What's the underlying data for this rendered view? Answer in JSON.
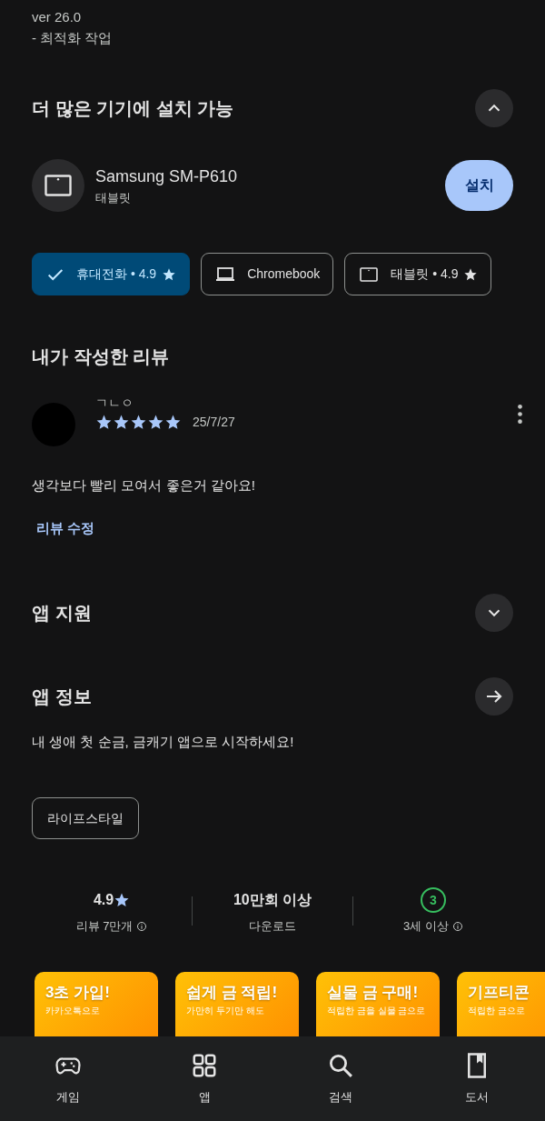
{
  "whats_new": [
    "ver 26.0",
    "- 최적화 작업"
  ],
  "devices_section": {
    "title": "더 많은 기기에 설치 가능",
    "expanded": true,
    "device": {
      "name": "Samsung SM-P610",
      "type": "태블릿",
      "button": "설치"
    },
    "chips": [
      {
        "label": "휴대전화 • 4.9",
        "selected": true,
        "rated": true
      },
      {
        "label": "Chromebook",
        "kind": "laptop",
        "selected": false,
        "rated": false
      },
      {
        "label": "태블릿 • 4.9",
        "kind": "tablet",
        "selected": false,
        "rated": true
      }
    ]
  },
  "my_review": {
    "title": "내가 작성한 리뷰",
    "author": "ㄱㄴㅇ",
    "stars": 5,
    "date": "25/7/27",
    "text": "생각보다 빨리 모여서 좋은거 같아요!",
    "edit_link": "리뷰 수정"
  },
  "support": {
    "title": "앱 지원",
    "expanded": false
  },
  "app_info": {
    "title": "앱 정보",
    "description": "내 생애 첫 순금, 금캐기 앱으로 시작하세요!",
    "category": "라이프스타일"
  },
  "stats": [
    {
      "kind": "rating",
      "value": "4.9",
      "label": "리뷰 7만개",
      "info": true
    },
    {
      "kind": "plain",
      "value": "10만회 이상",
      "label": "다운로드",
      "info": false
    },
    {
      "kind": "age",
      "value": "3",
      "label": "3세 이상",
      "info": true
    }
  ],
  "screenshots": [
    {
      "title": "3초 가입!",
      "subtitle": "카카오톡으로"
    },
    {
      "title": "쉽게 금 적립!",
      "subtitle": "가만히 두기만 해도"
    },
    {
      "title": "실물 금 구매!",
      "subtitle": "적립한 금을 실물 금으로"
    },
    {
      "title": "기프티콘",
      "subtitle": "적립한 금으로"
    }
  ],
  "bottom_nav": [
    {
      "label": "게임",
      "kind": "games"
    },
    {
      "label": "앱",
      "kind": "apps"
    },
    {
      "label": "검색",
      "kind": "search"
    },
    {
      "label": "도서",
      "kind": "books"
    }
  ]
}
